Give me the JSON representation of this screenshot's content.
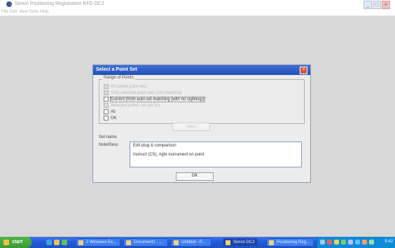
{
  "app": {
    "title": "Simon Positioning Registration RFD DC2",
    "menu": [
      "File",
      "Edit",
      "View",
      "Tools",
      "Help"
    ]
  },
  "dialog": {
    "title": "Select a Point Set",
    "group_title": "Range of Points",
    "options": [
      {
        "label": "All saved point sets",
        "checked": true,
        "enabled": false
      },
      {
        "label": "Only selected point sets (set matching",
        "checked": true,
        "enabled": false
      },
      {
        "label": "Current (from auto set matching (with no sighting))",
        "checked": false,
        "enabled": true,
        "focused": true
      },
      {
        "label": "Selected points set per list",
        "checked": false,
        "enabled": false
      },
      {
        "label": "All",
        "checked": false,
        "enabled": true
      },
      {
        "label": "OK",
        "checked": false,
        "enabled": true
      }
    ],
    "action_button": "Select",
    "field1_label": "Set name",
    "field2_label": "Note/Desc",
    "textarea_lines": [
      "Edit plug & comparison",
      "Instruct (CS), right instrument on point"
    ],
    "ok_button": "OK"
  },
  "taskbar": {
    "start_label": "start",
    "tasks": [
      {
        "label": "2 Windows Ex...",
        "active": false
      },
      {
        "label": "Document1 - ...",
        "active": false
      },
      {
        "label": "Untitled - P...",
        "active": false
      },
      {
        "label": "Simon DC2",
        "active": true
      },
      {
        "label": "Positioning Reg...",
        "active": false
      }
    ],
    "clock": "9:42"
  },
  "colors": {
    "dialog_title_bar": "#2a5dc9",
    "taskbar": "#245edb",
    "start_button": "#3f9f38",
    "tray": "#0f8ad9"
  }
}
